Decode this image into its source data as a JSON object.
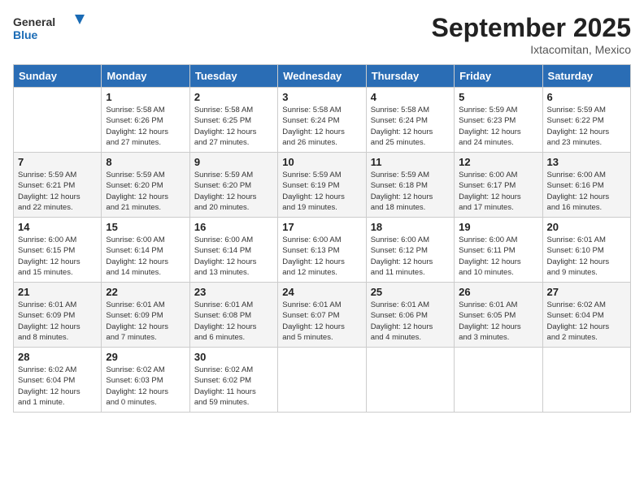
{
  "header": {
    "logo_general": "General",
    "logo_blue": "Blue",
    "month_title": "September 2025",
    "location": "Ixtacomitan, Mexico"
  },
  "days_of_week": [
    "Sunday",
    "Monday",
    "Tuesday",
    "Wednesday",
    "Thursday",
    "Friday",
    "Saturday"
  ],
  "weeks": [
    [
      {
        "day": "",
        "info": ""
      },
      {
        "day": "1",
        "info": "Sunrise: 5:58 AM\nSunset: 6:26 PM\nDaylight: 12 hours\nand 27 minutes."
      },
      {
        "day": "2",
        "info": "Sunrise: 5:58 AM\nSunset: 6:25 PM\nDaylight: 12 hours\nand 27 minutes."
      },
      {
        "day": "3",
        "info": "Sunrise: 5:58 AM\nSunset: 6:24 PM\nDaylight: 12 hours\nand 26 minutes."
      },
      {
        "day": "4",
        "info": "Sunrise: 5:58 AM\nSunset: 6:24 PM\nDaylight: 12 hours\nand 25 minutes."
      },
      {
        "day": "5",
        "info": "Sunrise: 5:59 AM\nSunset: 6:23 PM\nDaylight: 12 hours\nand 24 minutes."
      },
      {
        "day": "6",
        "info": "Sunrise: 5:59 AM\nSunset: 6:22 PM\nDaylight: 12 hours\nand 23 minutes."
      }
    ],
    [
      {
        "day": "7",
        "info": "Sunrise: 5:59 AM\nSunset: 6:21 PM\nDaylight: 12 hours\nand 22 minutes."
      },
      {
        "day": "8",
        "info": "Sunrise: 5:59 AM\nSunset: 6:20 PM\nDaylight: 12 hours\nand 21 minutes."
      },
      {
        "day": "9",
        "info": "Sunrise: 5:59 AM\nSunset: 6:20 PM\nDaylight: 12 hours\nand 20 minutes."
      },
      {
        "day": "10",
        "info": "Sunrise: 5:59 AM\nSunset: 6:19 PM\nDaylight: 12 hours\nand 19 minutes."
      },
      {
        "day": "11",
        "info": "Sunrise: 5:59 AM\nSunset: 6:18 PM\nDaylight: 12 hours\nand 18 minutes."
      },
      {
        "day": "12",
        "info": "Sunrise: 6:00 AM\nSunset: 6:17 PM\nDaylight: 12 hours\nand 17 minutes."
      },
      {
        "day": "13",
        "info": "Sunrise: 6:00 AM\nSunset: 6:16 PM\nDaylight: 12 hours\nand 16 minutes."
      }
    ],
    [
      {
        "day": "14",
        "info": "Sunrise: 6:00 AM\nSunset: 6:15 PM\nDaylight: 12 hours\nand 15 minutes."
      },
      {
        "day": "15",
        "info": "Sunrise: 6:00 AM\nSunset: 6:14 PM\nDaylight: 12 hours\nand 14 minutes."
      },
      {
        "day": "16",
        "info": "Sunrise: 6:00 AM\nSunset: 6:14 PM\nDaylight: 12 hours\nand 13 minutes."
      },
      {
        "day": "17",
        "info": "Sunrise: 6:00 AM\nSunset: 6:13 PM\nDaylight: 12 hours\nand 12 minutes."
      },
      {
        "day": "18",
        "info": "Sunrise: 6:00 AM\nSunset: 6:12 PM\nDaylight: 12 hours\nand 11 minutes."
      },
      {
        "day": "19",
        "info": "Sunrise: 6:00 AM\nSunset: 6:11 PM\nDaylight: 12 hours\nand 10 minutes."
      },
      {
        "day": "20",
        "info": "Sunrise: 6:01 AM\nSunset: 6:10 PM\nDaylight: 12 hours\nand 9 minutes."
      }
    ],
    [
      {
        "day": "21",
        "info": "Sunrise: 6:01 AM\nSunset: 6:09 PM\nDaylight: 12 hours\nand 8 minutes."
      },
      {
        "day": "22",
        "info": "Sunrise: 6:01 AM\nSunset: 6:09 PM\nDaylight: 12 hours\nand 7 minutes."
      },
      {
        "day": "23",
        "info": "Sunrise: 6:01 AM\nSunset: 6:08 PM\nDaylight: 12 hours\nand 6 minutes."
      },
      {
        "day": "24",
        "info": "Sunrise: 6:01 AM\nSunset: 6:07 PM\nDaylight: 12 hours\nand 5 minutes."
      },
      {
        "day": "25",
        "info": "Sunrise: 6:01 AM\nSunset: 6:06 PM\nDaylight: 12 hours\nand 4 minutes."
      },
      {
        "day": "26",
        "info": "Sunrise: 6:01 AM\nSunset: 6:05 PM\nDaylight: 12 hours\nand 3 minutes."
      },
      {
        "day": "27",
        "info": "Sunrise: 6:02 AM\nSunset: 6:04 PM\nDaylight: 12 hours\nand 2 minutes."
      }
    ],
    [
      {
        "day": "28",
        "info": "Sunrise: 6:02 AM\nSunset: 6:04 PM\nDaylight: 12 hours\nand 1 minute."
      },
      {
        "day": "29",
        "info": "Sunrise: 6:02 AM\nSunset: 6:03 PM\nDaylight: 12 hours\nand 0 minutes."
      },
      {
        "day": "30",
        "info": "Sunrise: 6:02 AM\nSunset: 6:02 PM\nDaylight: 11 hours\nand 59 minutes."
      },
      {
        "day": "",
        "info": ""
      },
      {
        "day": "",
        "info": ""
      },
      {
        "day": "",
        "info": ""
      },
      {
        "day": "",
        "info": ""
      }
    ]
  ]
}
